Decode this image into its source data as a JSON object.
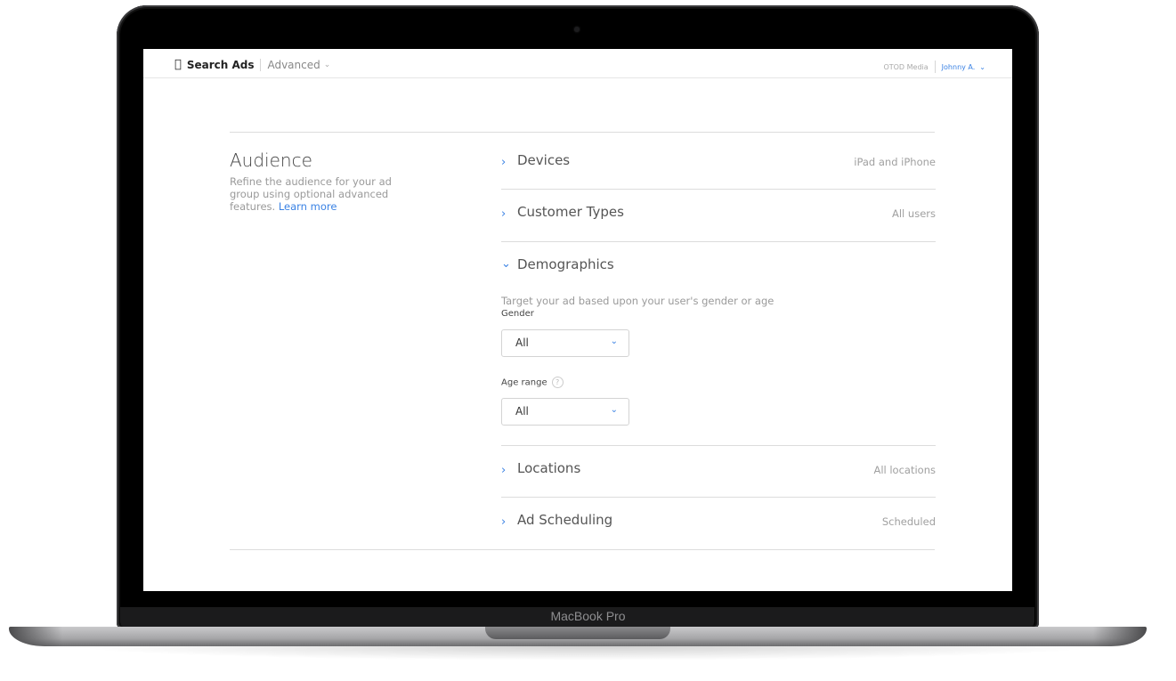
{
  "device": {
    "label": "MacBook Pro"
  },
  "header": {
    "brand": "Search Ads",
    "mode": "Advanced",
    "org": "OTOD Media",
    "user": "Johnny A."
  },
  "audience": {
    "title": "Audience",
    "description": "Refine the audience for your ad group using optional advanced features.",
    "learn_more": "Learn more"
  },
  "sections": [
    {
      "label": "Devices",
      "value": "iPad and iPhone",
      "expanded": false
    },
    {
      "label": "Customer Types",
      "value": "All users",
      "expanded": false
    },
    {
      "label": "Demographics",
      "value": "",
      "expanded": true
    },
    {
      "label": "Locations",
      "value": "All locations",
      "expanded": false
    },
    {
      "label": "Ad Scheduling",
      "value": "Scheduled",
      "expanded": false
    }
  ],
  "demographics": {
    "hint": "Target your ad based upon your user's gender or age",
    "gender_label": "Gender",
    "gender_value": "All",
    "age_label": "Age range",
    "age_value": "All"
  },
  "icons": {
    "apple": "",
    "chevron_right": "›",
    "chevron_down": "⌄",
    "help": "?"
  },
  "colors": {
    "accent": "#3a82e4"
  }
}
